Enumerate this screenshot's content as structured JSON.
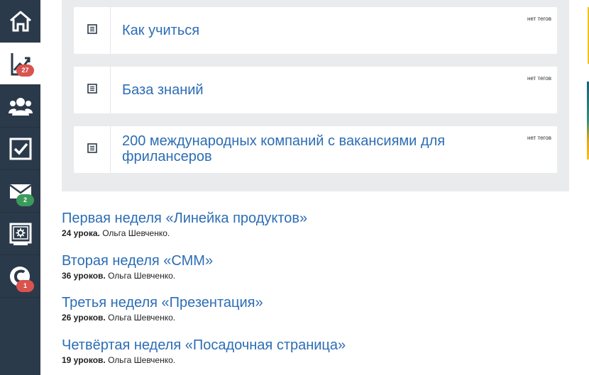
{
  "sidebar": {
    "items": [
      {
        "name": "home",
        "icon": "home-icon",
        "badge": ""
      },
      {
        "name": "activity",
        "icon": "chart-up-icon",
        "badge": "27",
        "badge_color": "#d9534f"
      },
      {
        "name": "users",
        "icon": "users-icon",
        "badge": ""
      },
      {
        "name": "tasks",
        "icon": "checkbox-icon",
        "badge": ""
      },
      {
        "name": "messages",
        "icon": "mail-icon",
        "badge": "2",
        "badge_color": "#3a9a5b"
      },
      {
        "name": "settings",
        "icon": "settings-monitor-icon",
        "badge": ""
      },
      {
        "name": "copyright",
        "icon": "copyright-icon",
        "badge": "1",
        "badge_color": "#d9534f"
      }
    ]
  },
  "cards": [
    {
      "title": "Как учиться",
      "tags": "нет тегов"
    },
    {
      "title": "База знаний",
      "tags": "нет тегов"
    },
    {
      "title": "200 международных компаний с вакансиями для фрилансеров",
      "tags": "нет тегов"
    }
  ],
  "courses": [
    {
      "title": "Первая неделя «Линейка продуктов»",
      "lessons": "24 урока.",
      "author": "Ольга Шевченко."
    },
    {
      "title": "Вторая неделя «СММ»",
      "lessons": "36 уроков.",
      "author": "Ольга Шевченко."
    },
    {
      "title": "Третья неделя «Презентация»",
      "lessons": "26 уроков.",
      "author": "Ольга Шевченко."
    },
    {
      "title": "Четвёртая неделя «Посадочная страница»",
      "lessons": "19 уроков.",
      "author": "Ольга Шевченко."
    }
  ],
  "colors": {
    "sidebar": "#2b3a4a",
    "link": "#2c6db5",
    "panel": "#e9ebed"
  }
}
